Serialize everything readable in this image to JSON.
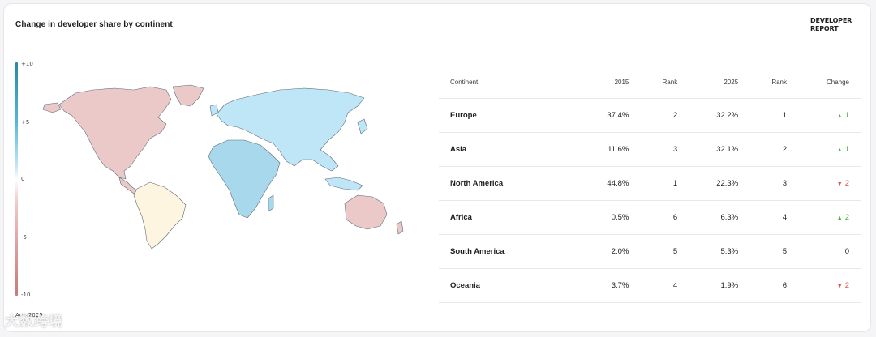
{
  "title": "Change in developer share by continent",
  "logo": "DEVELOPER REPORT",
  "date_label": "Aug 2025",
  "watermark": "大数跨境",
  "legend": {
    "ticks": [
      "+10",
      "+5",
      "0",
      "-5",
      "-10"
    ]
  },
  "table": {
    "columns": [
      "Continent",
      "2015",
      "Rank",
      "2025",
      "Rank",
      "Change"
    ],
    "rows": [
      {
        "continent": "Europe",
        "share_2015": "37.4%",
        "rank_2015": "2",
        "share_2025": "32.2%",
        "rank_2025": "1",
        "change": "1",
        "direction": "up"
      },
      {
        "continent": "Asia",
        "share_2015": "11.6%",
        "rank_2015": "3",
        "share_2025": "32.1%",
        "rank_2025": "2",
        "change": "1",
        "direction": "up"
      },
      {
        "continent": "North America",
        "share_2015": "44.8%",
        "rank_2015": "1",
        "share_2025": "22.3%",
        "rank_2025": "3",
        "change": "2",
        "direction": "down"
      },
      {
        "continent": "Africa",
        "share_2015": "0.5%",
        "rank_2015": "6",
        "share_2025": "6.3%",
        "rank_2025": "4",
        "change": "2",
        "direction": "up"
      },
      {
        "continent": "South America",
        "share_2015": "2.0%",
        "rank_2015": "5",
        "share_2025": "5.3%",
        "rank_2025": "5",
        "change": "0",
        "direction": "flat"
      },
      {
        "continent": "Oceania",
        "share_2015": "3.7%",
        "rank_2015": "4",
        "share_2025": "1.9%",
        "rank_2025": "6",
        "change": "2",
        "direction": "down"
      }
    ]
  },
  "colors": {
    "negative": "#ecc9c9",
    "neutral": "#fdf5df",
    "positive": "#bfe6f7",
    "positive_strong": "#a7d8ec",
    "up": "#4caf50",
    "down": "#d9534f"
  }
}
